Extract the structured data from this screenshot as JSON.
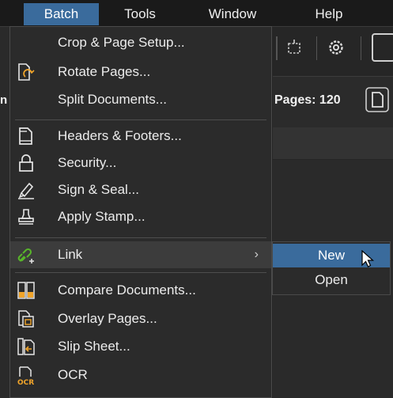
{
  "menubar": {
    "items": [
      "Batch",
      "Tools",
      "Window",
      "Help"
    ],
    "active": "Batch"
  },
  "background": {
    "pages_label": "Pages: 120",
    "left_fragment": "n"
  },
  "dropdown": {
    "items": [
      {
        "label": "Crop & Page Setup...",
        "icon": "none"
      },
      {
        "label": "Rotate Pages...",
        "icon": "rotate-pages-icon"
      },
      {
        "label": "Split Documents...",
        "icon": "none"
      },
      {
        "label": "Headers & Footers...",
        "icon": "headers-footers-icon"
      },
      {
        "label": "Security...",
        "icon": "lock-icon"
      },
      {
        "label": "Sign & Seal...",
        "icon": "pen-sign-icon"
      },
      {
        "label": "Apply Stamp...",
        "icon": "stamp-icon"
      },
      {
        "label": "Link",
        "icon": "link-add-icon",
        "has_submenu": true,
        "arrow": "›"
      },
      {
        "label": "Compare Documents...",
        "icon": "compare-icon"
      },
      {
        "label": "Overlay Pages...",
        "icon": "overlay-icon"
      },
      {
        "label": "Slip Sheet...",
        "icon": "slip-sheet-icon"
      },
      {
        "label": "OCR",
        "icon": "ocr-icon",
        "icon_text": "OCR"
      }
    ]
  },
  "submenu": {
    "items": [
      "New",
      "Open"
    ],
    "active": "New"
  },
  "colors": {
    "menu_bg": "#2b2b2b",
    "highlight": "#3a6b9c",
    "link_icon": "#58b52a"
  }
}
